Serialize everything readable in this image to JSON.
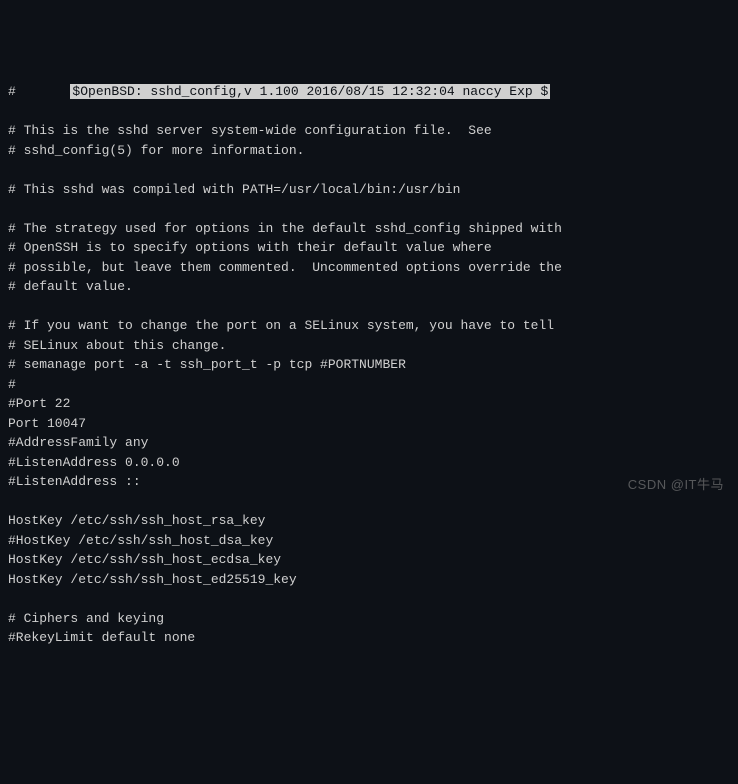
{
  "top": {
    "hash": "#",
    "label": "$OpenBSD: sshd_config,v 1.100 2016/08/15 12:32:04 naccy Exp $"
  },
  "lines": {
    "l2": "# This is the sshd server system-wide configuration file.  See",
    "l3": "# sshd_config(5) for more information.",
    "l4": "# This sshd was compiled with PATH=/usr/local/bin:/usr/bin",
    "l5": "# The strategy used for options in the default sshd_config shipped with",
    "l6": "# OpenSSH is to specify options with their default value where",
    "l7": "# possible, but leave them commented.  Uncommented options override the",
    "l8": "# default value.",
    "l9": "# If you want to change the port on a SELinux system, you have to tell",
    "l10": "# SELinux about this change.",
    "l11": "# semanage port -a -t ssh_port_t -p tcp #PORTNUMBER",
    "l12": "#",
    "l13": "#Port 22",
    "l14": "Port 10047",
    "l15": "#AddressFamily any",
    "l16": "#ListenAddress 0.0.0.0",
    "l17": "#ListenAddress ::",
    "l18": "HostKey /etc/ssh/ssh_host_rsa_key",
    "l19": "#HostKey /etc/ssh/ssh_host_dsa_key",
    "l20": "HostKey /etc/ssh/ssh_host_ecdsa_key",
    "l21": "HostKey /etc/ssh/ssh_host_ed25519_key",
    "l22": "# Ciphers and keying",
    "l23": "#RekeyLimit default none"
  },
  "watermark": "CSDN @IT牛马"
}
